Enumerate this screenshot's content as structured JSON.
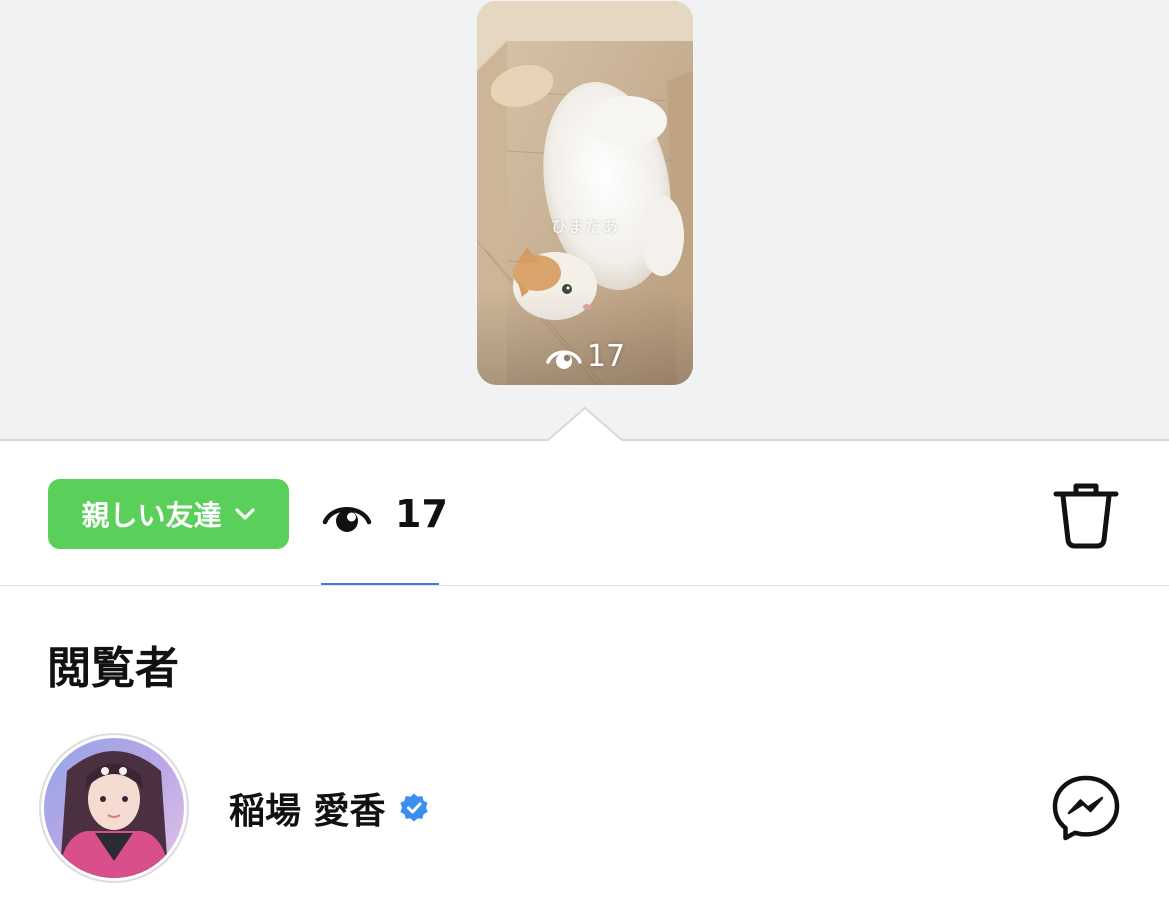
{
  "story": {
    "caption": "ひまだあ",
    "view_count": "17"
  },
  "toolbar": {
    "audience_label": "親しい友達",
    "view_count": "17"
  },
  "viewers": {
    "title": "閲覧者",
    "items": [
      {
        "name": "稲場 愛香",
        "verified": true
      }
    ]
  },
  "colors": {
    "background_top": "#f1f2f4",
    "audience_button": "#5ad05a",
    "tab_underline": "#3b7fe0",
    "verified_badge": "#3b8ff0"
  },
  "icons": {
    "eye": "eye-icon",
    "chevron": "chevron-down-icon",
    "trash": "trash-icon",
    "messenger": "messenger-icon",
    "verified": "verified-badge-icon"
  }
}
